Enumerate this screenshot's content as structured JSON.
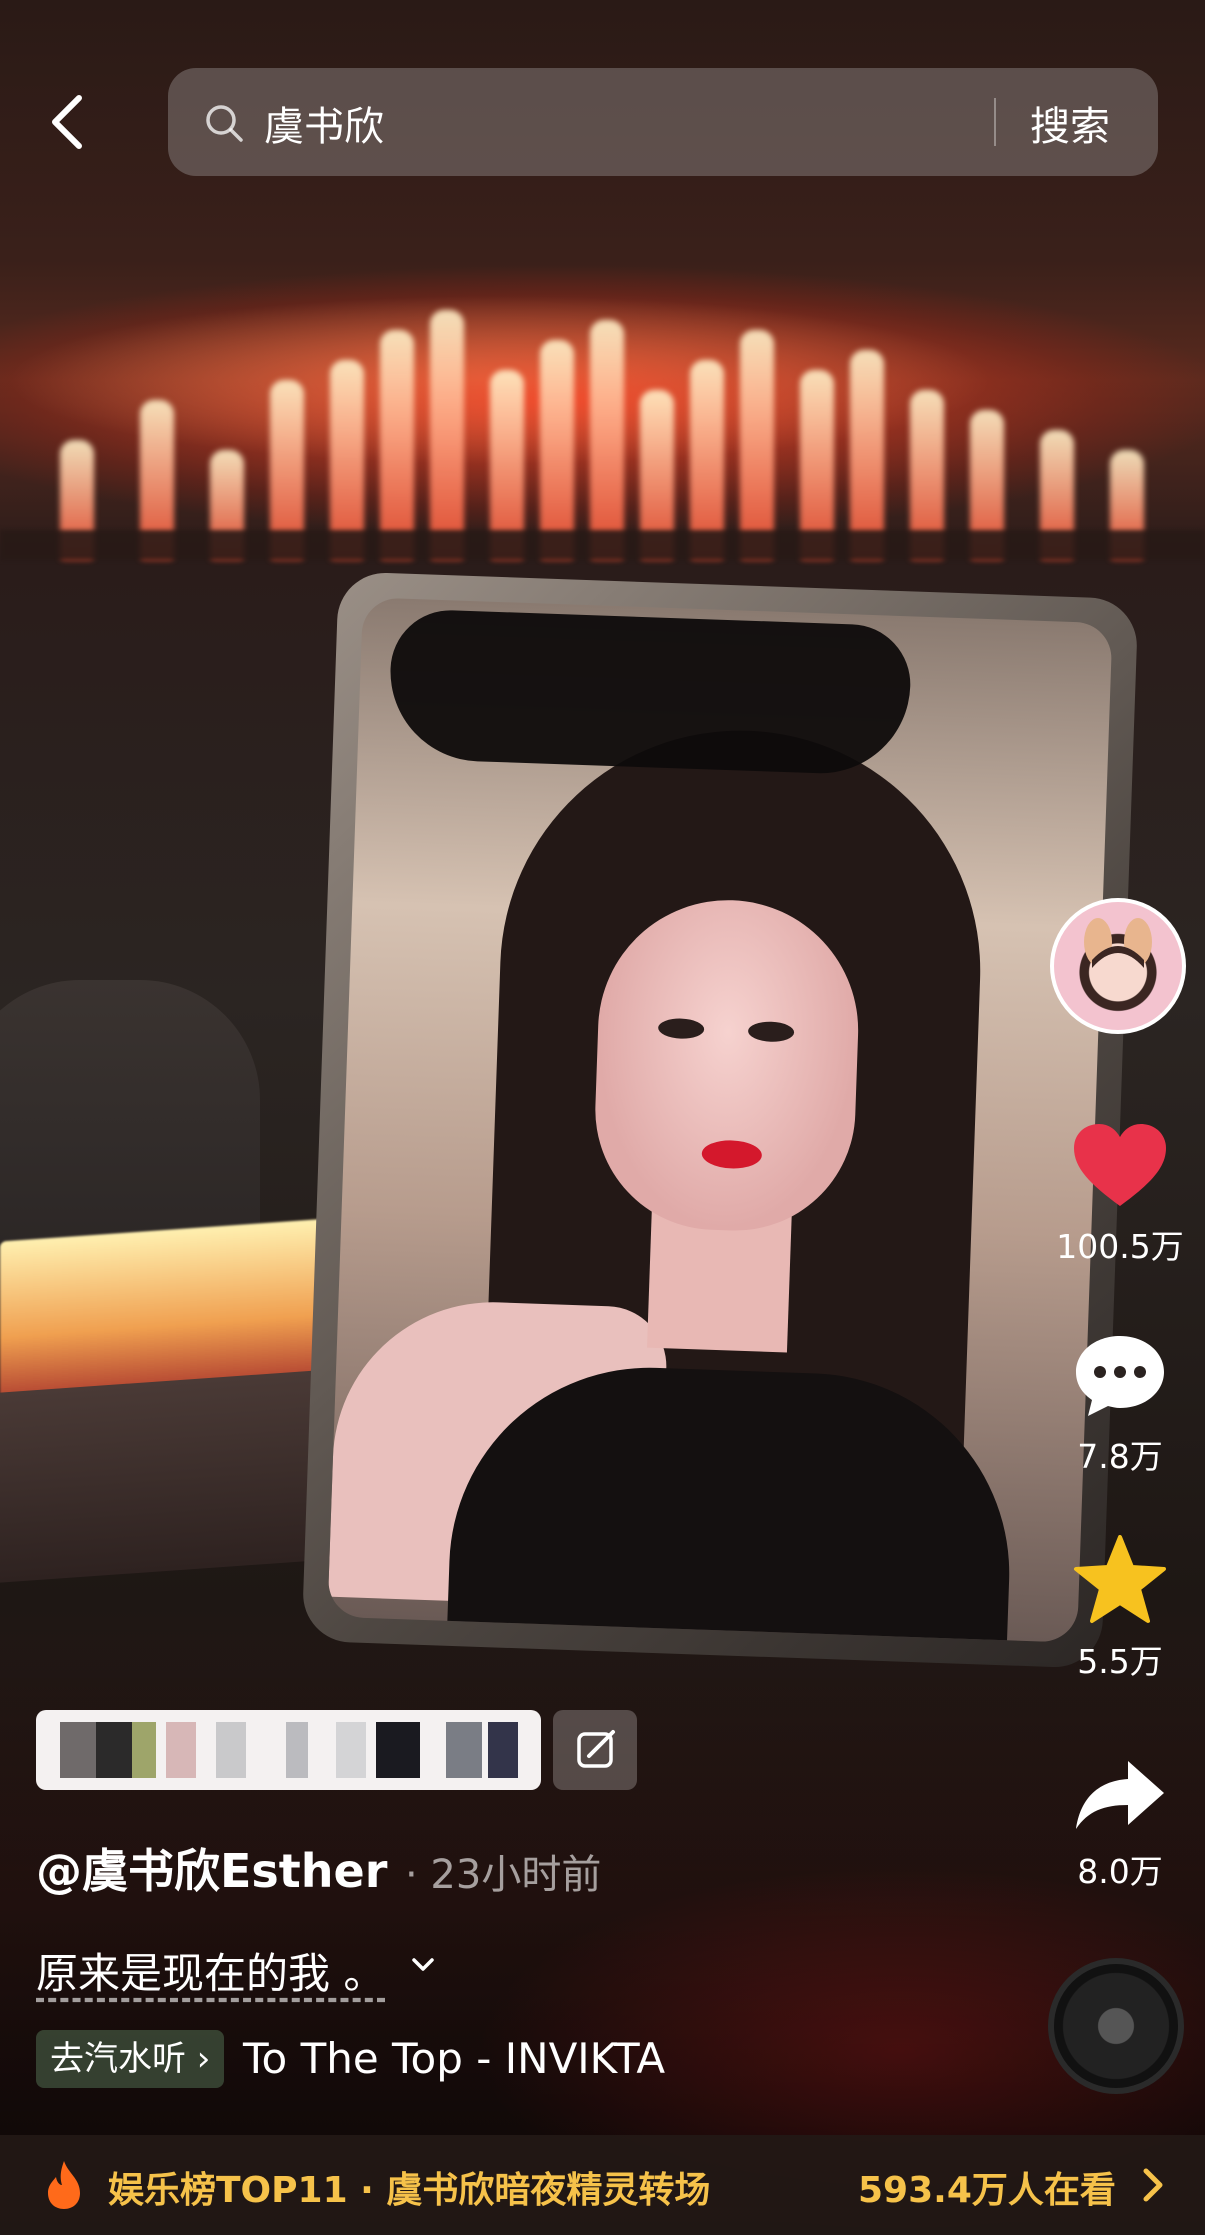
{
  "search": {
    "query": "虞书欣",
    "button_label": "搜索"
  },
  "rail": {
    "likes": "100.5万",
    "comments": "7.8万",
    "favorites": "5.5万",
    "shares": "8.0万"
  },
  "post": {
    "author": "@虞书欣Esther",
    "time": "· 23小时前",
    "caption": "原来是现在的我 。",
    "music_chip": "去汽水听 ›",
    "music_title": "To The Top - INVIKTA"
  },
  "hot": {
    "label": "娱乐榜TOP11 · 虞书欣暗夜精灵转场",
    "viewers": "593.4万人在看"
  },
  "colors": {
    "like_red": "#e8324a",
    "favorite_yellow": "#f7c21f",
    "hot_gold": "#f6c24a"
  }
}
